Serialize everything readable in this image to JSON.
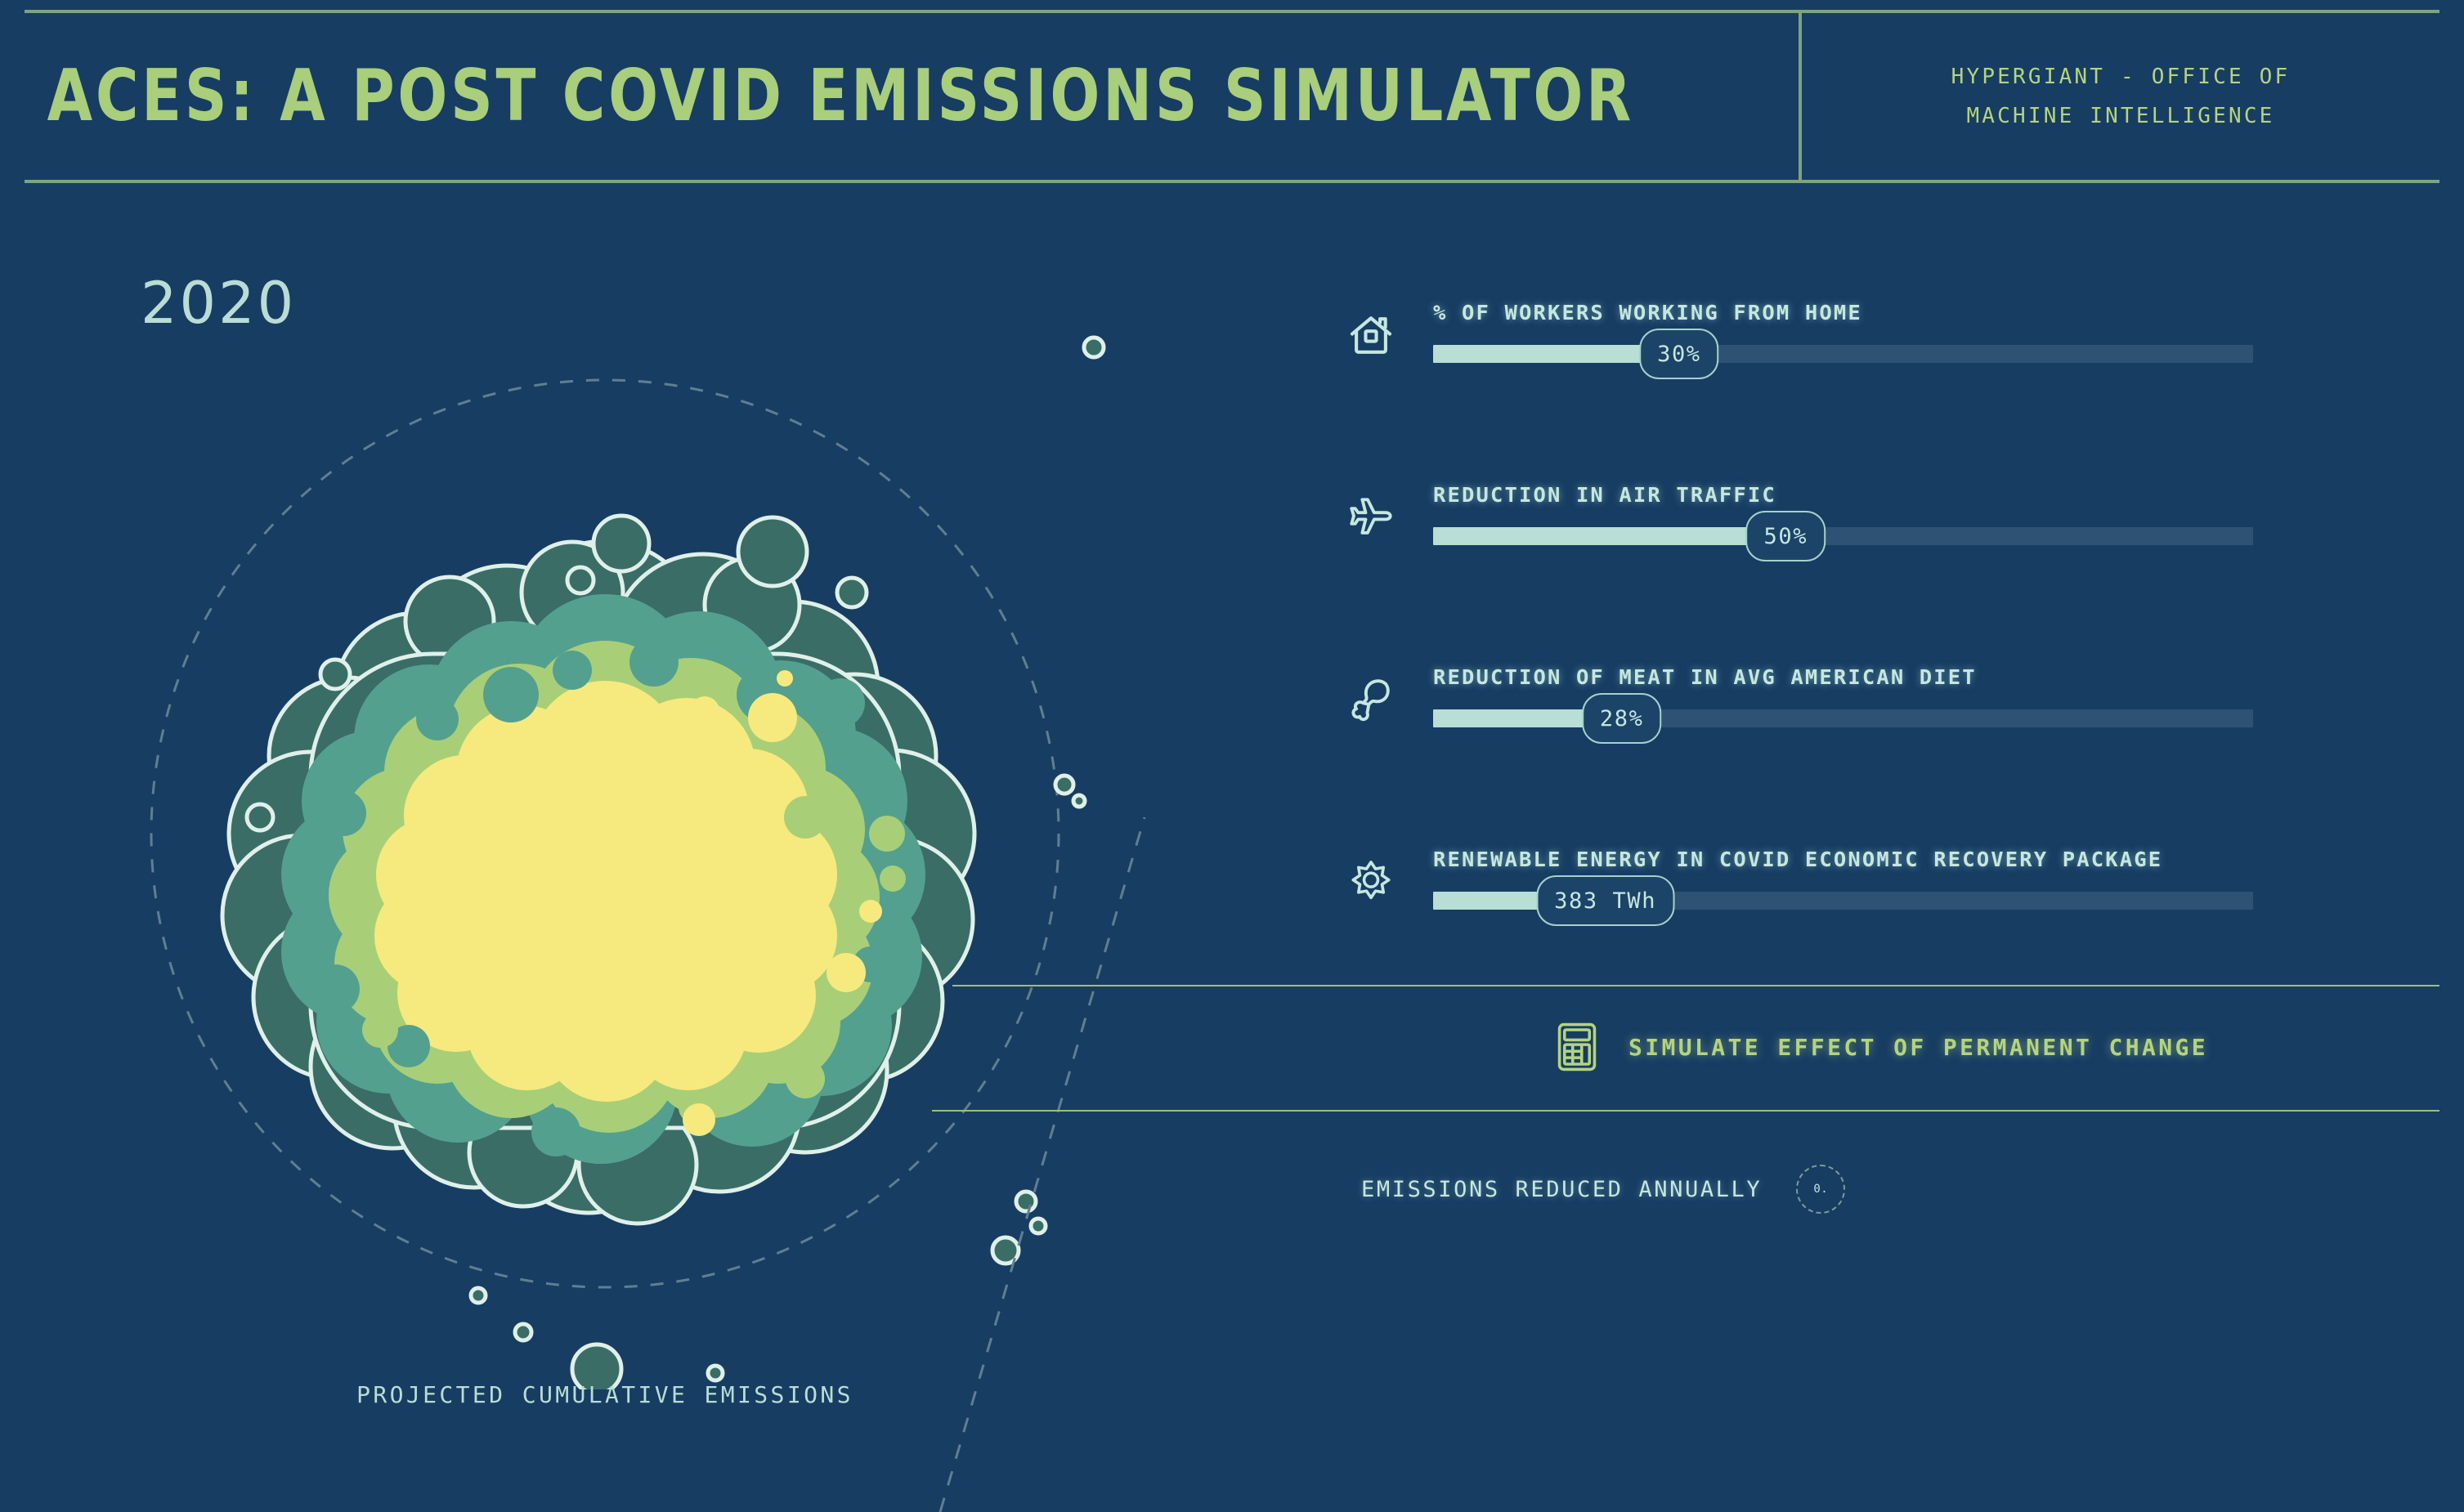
{
  "header": {
    "title": "ACES: A POST COVID EMISSIONS SIMULATOR",
    "org_line1": "HYPERGIANT - OFFICE OF",
    "org_line2": "MACHINE INTELLIGENCE"
  },
  "visual": {
    "year": "2020",
    "caption": "PROJECTED CUMULATIVE EMISSIONS"
  },
  "controls": [
    {
      "icon": "house-icon",
      "label": "% OF WORKERS WORKING FROM HOME",
      "value": "30%",
      "percent": 30
    },
    {
      "icon": "airplane-icon",
      "label": "REDUCTION IN AIR TRAFFIC",
      "value": "50%",
      "percent": 43
    },
    {
      "icon": "drumstick-icon",
      "label": "REDUCTION OF MEAT IN AVG AMERICAN DIET",
      "value": "28%",
      "percent": 23
    },
    {
      "icon": "sun-icon",
      "label": "RENEWABLE ENERGY IN COVID ECONOMIC RECOVERY PACKAGE",
      "value": "383 TWh",
      "percent": 21
    }
  ],
  "simulate": {
    "icon": "calculator-icon",
    "label": "SIMULATE EFFECT OF PERMANENT CHANGE"
  },
  "emissions": {
    "label": "EMISSIONS REDUCED ANNUALLY",
    "value": "0."
  },
  "colors": {
    "background": "#173d63",
    "accent_green": "#b4d47e",
    "rule_green": "#7fa37f",
    "text_light": "#c6e7e0",
    "slider_fill": "#b8ded5",
    "slider_track": "#2e5273",
    "cloud_outline": "#dff0ea",
    "cloud_dark": "#3a6d66",
    "cloud_mid": "#5aa08c",
    "cloud_green": "#a8cf78",
    "cloud_core": "#f6ea7e"
  },
  "chart_data": {
    "type": "bubble",
    "title": "PROJECTED CUMULATIVE EMISSIONS",
    "year": "2020",
    "layers": [
      {
        "name": "outer",
        "color": "#3a6d66",
        "radius_rel": 1.0
      },
      {
        "name": "mid",
        "color": "#5aa08c",
        "radius_rel": 0.84
      },
      {
        "name": "inner",
        "color": "#a8cf78",
        "radius_rel": 0.7
      },
      {
        "name": "core",
        "color": "#f6ea7e",
        "radius_rel": 0.58
      }
    ],
    "reference_ring_radius_rel": 1.32,
    "annotations": [
      "PROJECTED CUMULATIVE EMISSIONS"
    ]
  }
}
